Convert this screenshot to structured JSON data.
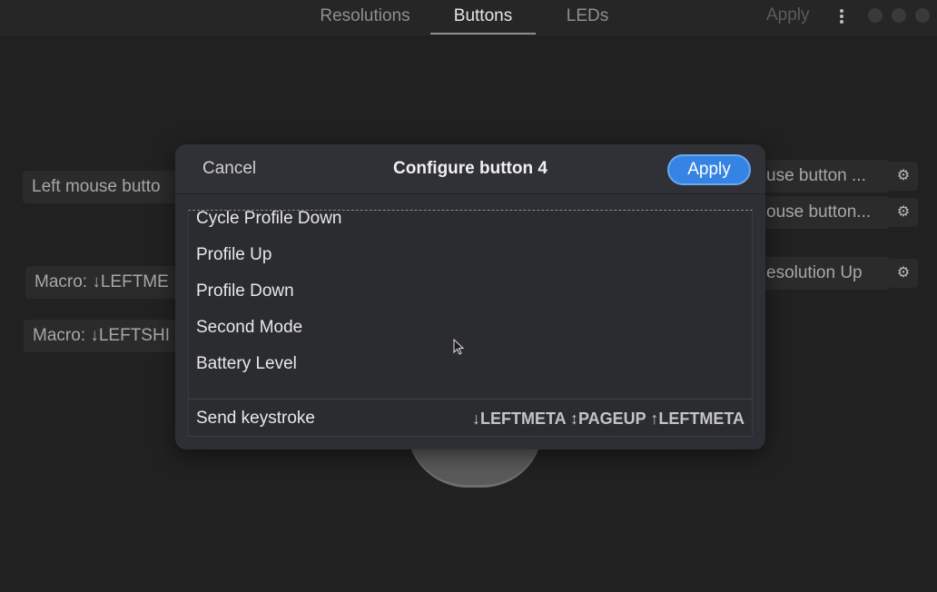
{
  "header": {
    "tabs": [
      {
        "label": "Resolutions"
      },
      {
        "label": "Buttons"
      },
      {
        "label": "LEDs"
      }
    ],
    "active_tab": "Buttons",
    "apply_label": "Apply",
    "menu_icon": "kebab-menu-icon"
  },
  "background": {
    "left_buttons": [
      {
        "label": "Left mouse butto"
      },
      {
        "label": "Macro: ↓LEFTME"
      },
      {
        "label": "Macro: ↓LEFTSHI"
      }
    ],
    "right_buttons": [
      {
        "label": "use button ..."
      },
      {
        "label": "ouse button..."
      },
      {
        "label": "esolution Up"
      }
    ],
    "gear_icon": "⚙"
  },
  "dialog": {
    "cancel_label": "Cancel",
    "title": "Configure button 4",
    "apply_label": "Apply",
    "items": [
      {
        "label": "Cycle Profile Down"
      },
      {
        "label": "Profile Up"
      },
      {
        "label": "Profile Down"
      },
      {
        "label": "Second Mode"
      },
      {
        "label": "Battery Level"
      }
    ],
    "keystroke": {
      "label": "Send keystroke",
      "value": "↓LEFTMETA ↕PAGEUP ↑LEFTMETA"
    }
  },
  "colors": {
    "accent": "#3584e4",
    "background": "#212121",
    "dialog": "#2e2f34"
  }
}
